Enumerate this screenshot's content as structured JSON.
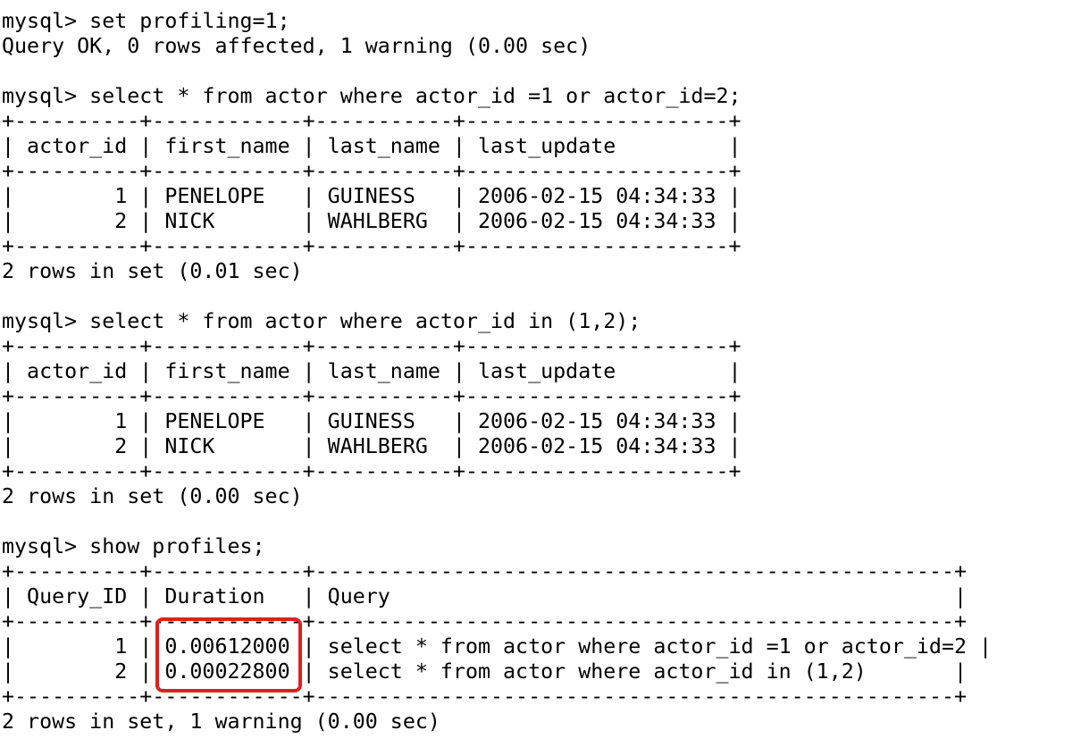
{
  "colors": {
    "background": "#ffffff",
    "text": "#000000",
    "highlight": "#e02020"
  },
  "terminal": {
    "lines": [
      "mysql> set profiling=1;",
      "Query OK, 0 rows affected, 1 warning (0.00 sec)",
      "",
      "mysql> select * from actor where actor_id =1 or actor_id=2;",
      "+----------+------------+-----------+---------------------+",
      "| actor_id | first_name | last_name | last_update         |",
      "+----------+------------+-----------+---------------------+",
      "|        1 | PENELOPE   | GUINESS   | 2006-02-15 04:34:33 |",
      "|        2 | NICK       | WAHLBERG  | 2006-02-15 04:34:33 |",
      "+----------+------------+-----------+---------------------+",
      "2 rows in set (0.01 sec)",
      "",
      "mysql> select * from actor where actor_id in (1,2);",
      "+----------+------------+-----------+---------------------+",
      "| actor_id | first_name | last_name | last_update         |",
      "+----------+------------+-----------+---------------------+",
      "|        1 | PENELOPE   | GUINESS   | 2006-02-15 04:34:33 |",
      "|        2 | NICK       | WAHLBERG  | 2006-02-15 04:34:33 |",
      "+----------+------------+-----------+---------------------+",
      "2 rows in set (0.00 sec)",
      "",
      "mysql> show profiles;",
      "+----------+------------+---------------------------------------------------+",
      "| Query_ID | Duration   | Query                                             |",
      "+----------+------------+---------------------------------------------------+",
      "|        1 | 0.00612000 | select * from actor where actor_id =1 or actor_id=2 |",
      "|        2 | 0.00022800 | select * from actor where actor_id in (1,2)       |",
      "+----------+------------+---------------------------------------------------+",
      "2 rows in set, 1 warning (0.00 sec)"
    ]
  }
}
